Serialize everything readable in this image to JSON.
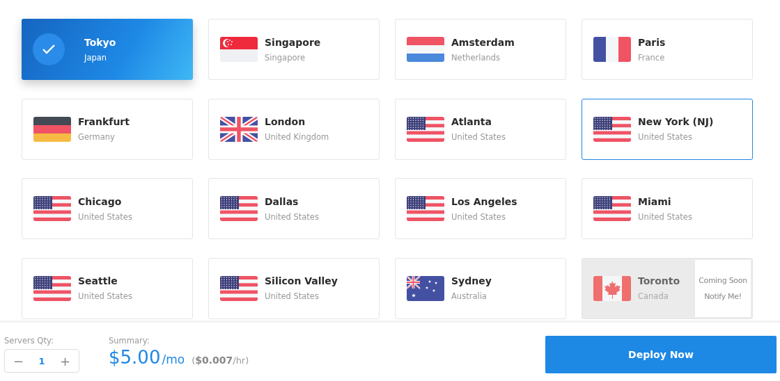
{
  "locations": [
    {
      "city": "Tokyo",
      "country": "Japan",
      "selected": true,
      "highlighted": false,
      "available": true
    },
    {
      "city": "Singapore",
      "country": "Singapore",
      "kind": "sg",
      "selected": false,
      "highlighted": false,
      "available": true
    },
    {
      "city": "Amsterdam",
      "country": "Netherlands",
      "kind": "nl",
      "selected": false,
      "highlighted": false,
      "available": true
    },
    {
      "city": "Paris",
      "country": "France",
      "kind": "fr",
      "selected": false,
      "highlighted": false,
      "available": true
    },
    {
      "city": "Frankfurt",
      "country": "Germany",
      "kind": "de",
      "selected": false,
      "highlighted": false,
      "available": true
    },
    {
      "city": "London",
      "country": "United Kingdom",
      "kind": "gb",
      "selected": false,
      "highlighted": false,
      "available": true
    },
    {
      "city": "Atlanta",
      "country": "United States",
      "kind": "us",
      "selected": false,
      "highlighted": false,
      "available": true
    },
    {
      "city": "New York (NJ)",
      "country": "United States",
      "kind": "us",
      "selected": false,
      "highlighted": true,
      "available": true
    },
    {
      "city": "Chicago",
      "country": "United States",
      "kind": "us",
      "selected": false,
      "highlighted": false,
      "available": true
    },
    {
      "city": "Dallas",
      "country": "United States",
      "kind": "us",
      "selected": false,
      "highlighted": false,
      "available": true
    },
    {
      "city": "Los Angeles",
      "country": "United States",
      "kind": "us",
      "selected": false,
      "highlighted": false,
      "available": true
    },
    {
      "city": "Miami",
      "country": "United States",
      "kind": "us",
      "selected": false,
      "highlighted": false,
      "available": true
    },
    {
      "city": "Seattle",
      "country": "United States",
      "kind": "us",
      "selected": false,
      "highlighted": false,
      "available": true
    },
    {
      "city": "Silicon Valley",
      "country": "United States",
      "kind": "us",
      "selected": false,
      "highlighted": false,
      "available": true
    },
    {
      "city": "Sydney",
      "country": "Australia",
      "kind": "au",
      "selected": false,
      "highlighted": false,
      "available": true
    },
    {
      "city": "Toronto",
      "country": "Canada",
      "kind": "ca",
      "selected": false,
      "highlighted": false,
      "available": false,
      "status": "Coming Soon",
      "action": "Notify Me!"
    }
  ],
  "footer": {
    "qty_label": "Servers Qty:",
    "decrement": "−",
    "quantity": "1",
    "increment": "+",
    "summary_label": "Summary:",
    "price": "$5.00",
    "price_unit": "/mo",
    "hourly": "(**$0.007**/hr)",
    "deploy_button": "Deploy Now"
  }
}
